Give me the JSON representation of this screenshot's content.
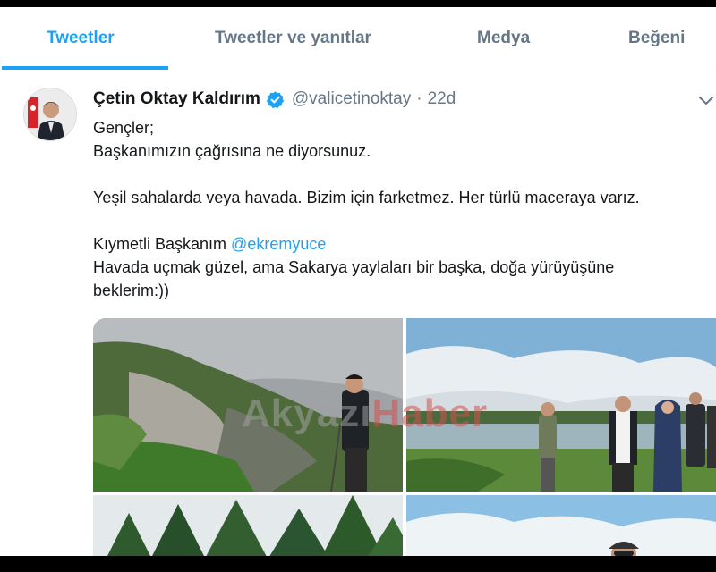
{
  "tabs": [
    {
      "label": "Tweetler",
      "active": true
    },
    {
      "label": "Tweetler ve yanıtlar",
      "active": false
    },
    {
      "label": "Medya",
      "active": false
    },
    {
      "label": "Beğeni",
      "active": false
    }
  ],
  "tweet": {
    "author_name": "Çetin Oktay Kaldırım",
    "handle": "@valicetinoktay",
    "separator": "·",
    "time": "22d",
    "lines": {
      "l1": "Gençler;",
      "l2": "Başkanımızın çağrısına ne diyorsunuz.",
      "l3": "Yeşil sahalarda veya havada. Bizim için farketmez. Her türlü maceraya varız.",
      "l4_prefix": "Kıymetli Başkanım ",
      "l4_mention": "@ekremyuce",
      "l5": "Havada uçmak güzel, ama Sakarya yaylaları bir başka, doğa yürüyüşüne",
      "l6": "beklerim:))"
    }
  },
  "watermark": {
    "part1": "Akyazı",
    "part2": "Haber"
  },
  "icons": {
    "verified": "verified-badge-icon",
    "more": "chevron-down-icon"
  },
  "colors": {
    "accent": "#1da1f2",
    "text": "#14171a",
    "muted": "#657786"
  }
}
